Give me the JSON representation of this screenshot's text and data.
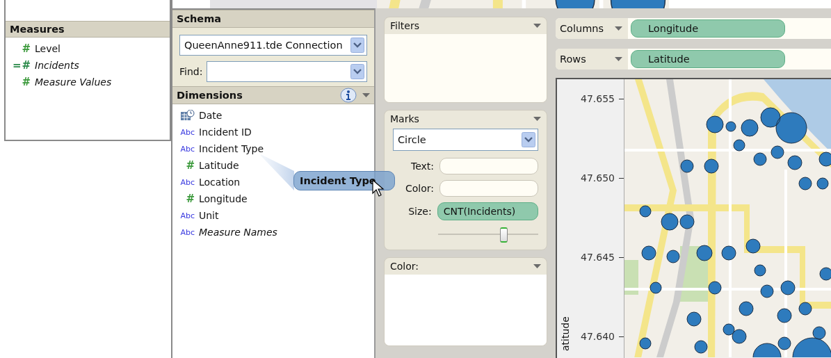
{
  "measures": {
    "title": "Measures",
    "items": [
      {
        "label": "Level",
        "kind": "number",
        "icon_text": "#",
        "italic": false
      },
      {
        "label": "Incidents",
        "kind": "calc",
        "icon_text": "=#",
        "italic": true
      },
      {
        "label": "Measure Values",
        "kind": "number",
        "icon_text": "#",
        "italic": true
      }
    ]
  },
  "schema": {
    "title": "Schema",
    "connection": "QueenAnne911.tde Connection",
    "find_label": "Find:"
  },
  "dimensions": {
    "title": "Dimensions",
    "items": [
      {
        "label": "Date",
        "kind": "date",
        "italic": false
      },
      {
        "label": "Incident ID",
        "kind": "string",
        "icon_text": "Abc",
        "italic": false
      },
      {
        "label": "Incident Type",
        "kind": "string",
        "icon_text": "Abc",
        "italic": false
      },
      {
        "label": "Latitude",
        "kind": "number",
        "icon_text": "#",
        "italic": false
      },
      {
        "label": "Location",
        "kind": "string",
        "icon_text": "Abc",
        "italic": false
      },
      {
        "label": "Longitude",
        "kind": "number",
        "icon_text": "#",
        "italic": false
      },
      {
        "label": "Unit",
        "kind": "string",
        "icon_text": "Abc",
        "italic": false
      },
      {
        "label": "Measure Names",
        "kind": "string",
        "icon_text": "Abc",
        "italic": true
      }
    ]
  },
  "drag_pill": {
    "label": "Incident Type"
  },
  "filters": {
    "title": "Filters"
  },
  "marks": {
    "title": "Marks",
    "mark_type": "Circle",
    "shelves": [
      {
        "label": "Text:"
      },
      {
        "label": "Color:"
      },
      {
        "label": "Size:",
        "pill": "CNT(Incidents)"
      }
    ],
    "size_slider": {
      "level": 0.65
    }
  },
  "color": {
    "title": "Color:"
  },
  "shelves": [
    {
      "label": "Columns",
      "pill": "Longitude"
    },
    {
      "label": "Rows",
      "pill": "Latitude"
    }
  ],
  "view": {
    "axis_title": "atitude",
    "ticks": [
      "47.655",
      "47.650",
      "47.645",
      "47.640"
    ]
  }
}
